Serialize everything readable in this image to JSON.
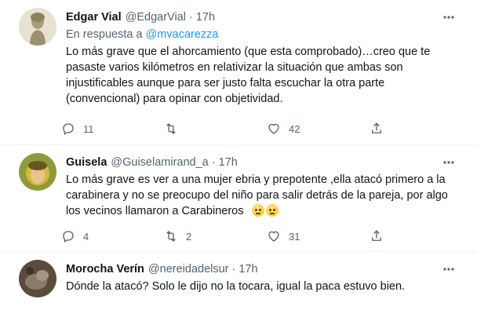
{
  "tweets": [
    {
      "name": "Edgar Vial",
      "handle": "@EdgarVial",
      "dot": "·",
      "time": "17h",
      "reply_prefix": "En respuesta a",
      "reply_mention": "@mvacarezza",
      "text": "Lo más grave que el ahorcamiento (que esta comprobado)…creo que te pasaste varios kilómetros en relativizar la situación que ambas son injustificables aunque para ser justo falta escuchar la otra parte (convencional) para opinar con objetividad.",
      "replies": "11",
      "retweets": "",
      "likes": "42",
      "avatar_color": "#b9ad8e"
    },
    {
      "name": "Guisela",
      "handle": "@Guiselamirand_a",
      "dot": "·",
      "time": "17h",
      "text": "Lo más grave es ver a una mujer ebria y prepotente  ,ella atacó  primero  a la carabinera  y no se preocupo  del niño para salir detrás de la pareja, por algo los vecinos llamaron  a Carabineros",
      "emoji_names": [
        "face-with-rolling-eyes-emoji",
        "face-with-rolling-eyes-emoji"
      ],
      "replies": "4",
      "retweets": "2",
      "likes": "31",
      "avatar_color": "#c9b23a"
    },
    {
      "name": "Morocha Verín",
      "handle": "@nereidadelsur",
      "dot": "·",
      "time": "17h",
      "text": "Dónde la atacó? Solo le dijo no la tocara, igual la paca estuvo bien.",
      "avatar_color": "#6b5a4a"
    }
  ],
  "colors": {
    "secondary_text": "#536471",
    "link": "#1d9bf0",
    "divider": "#eff3f4"
  }
}
